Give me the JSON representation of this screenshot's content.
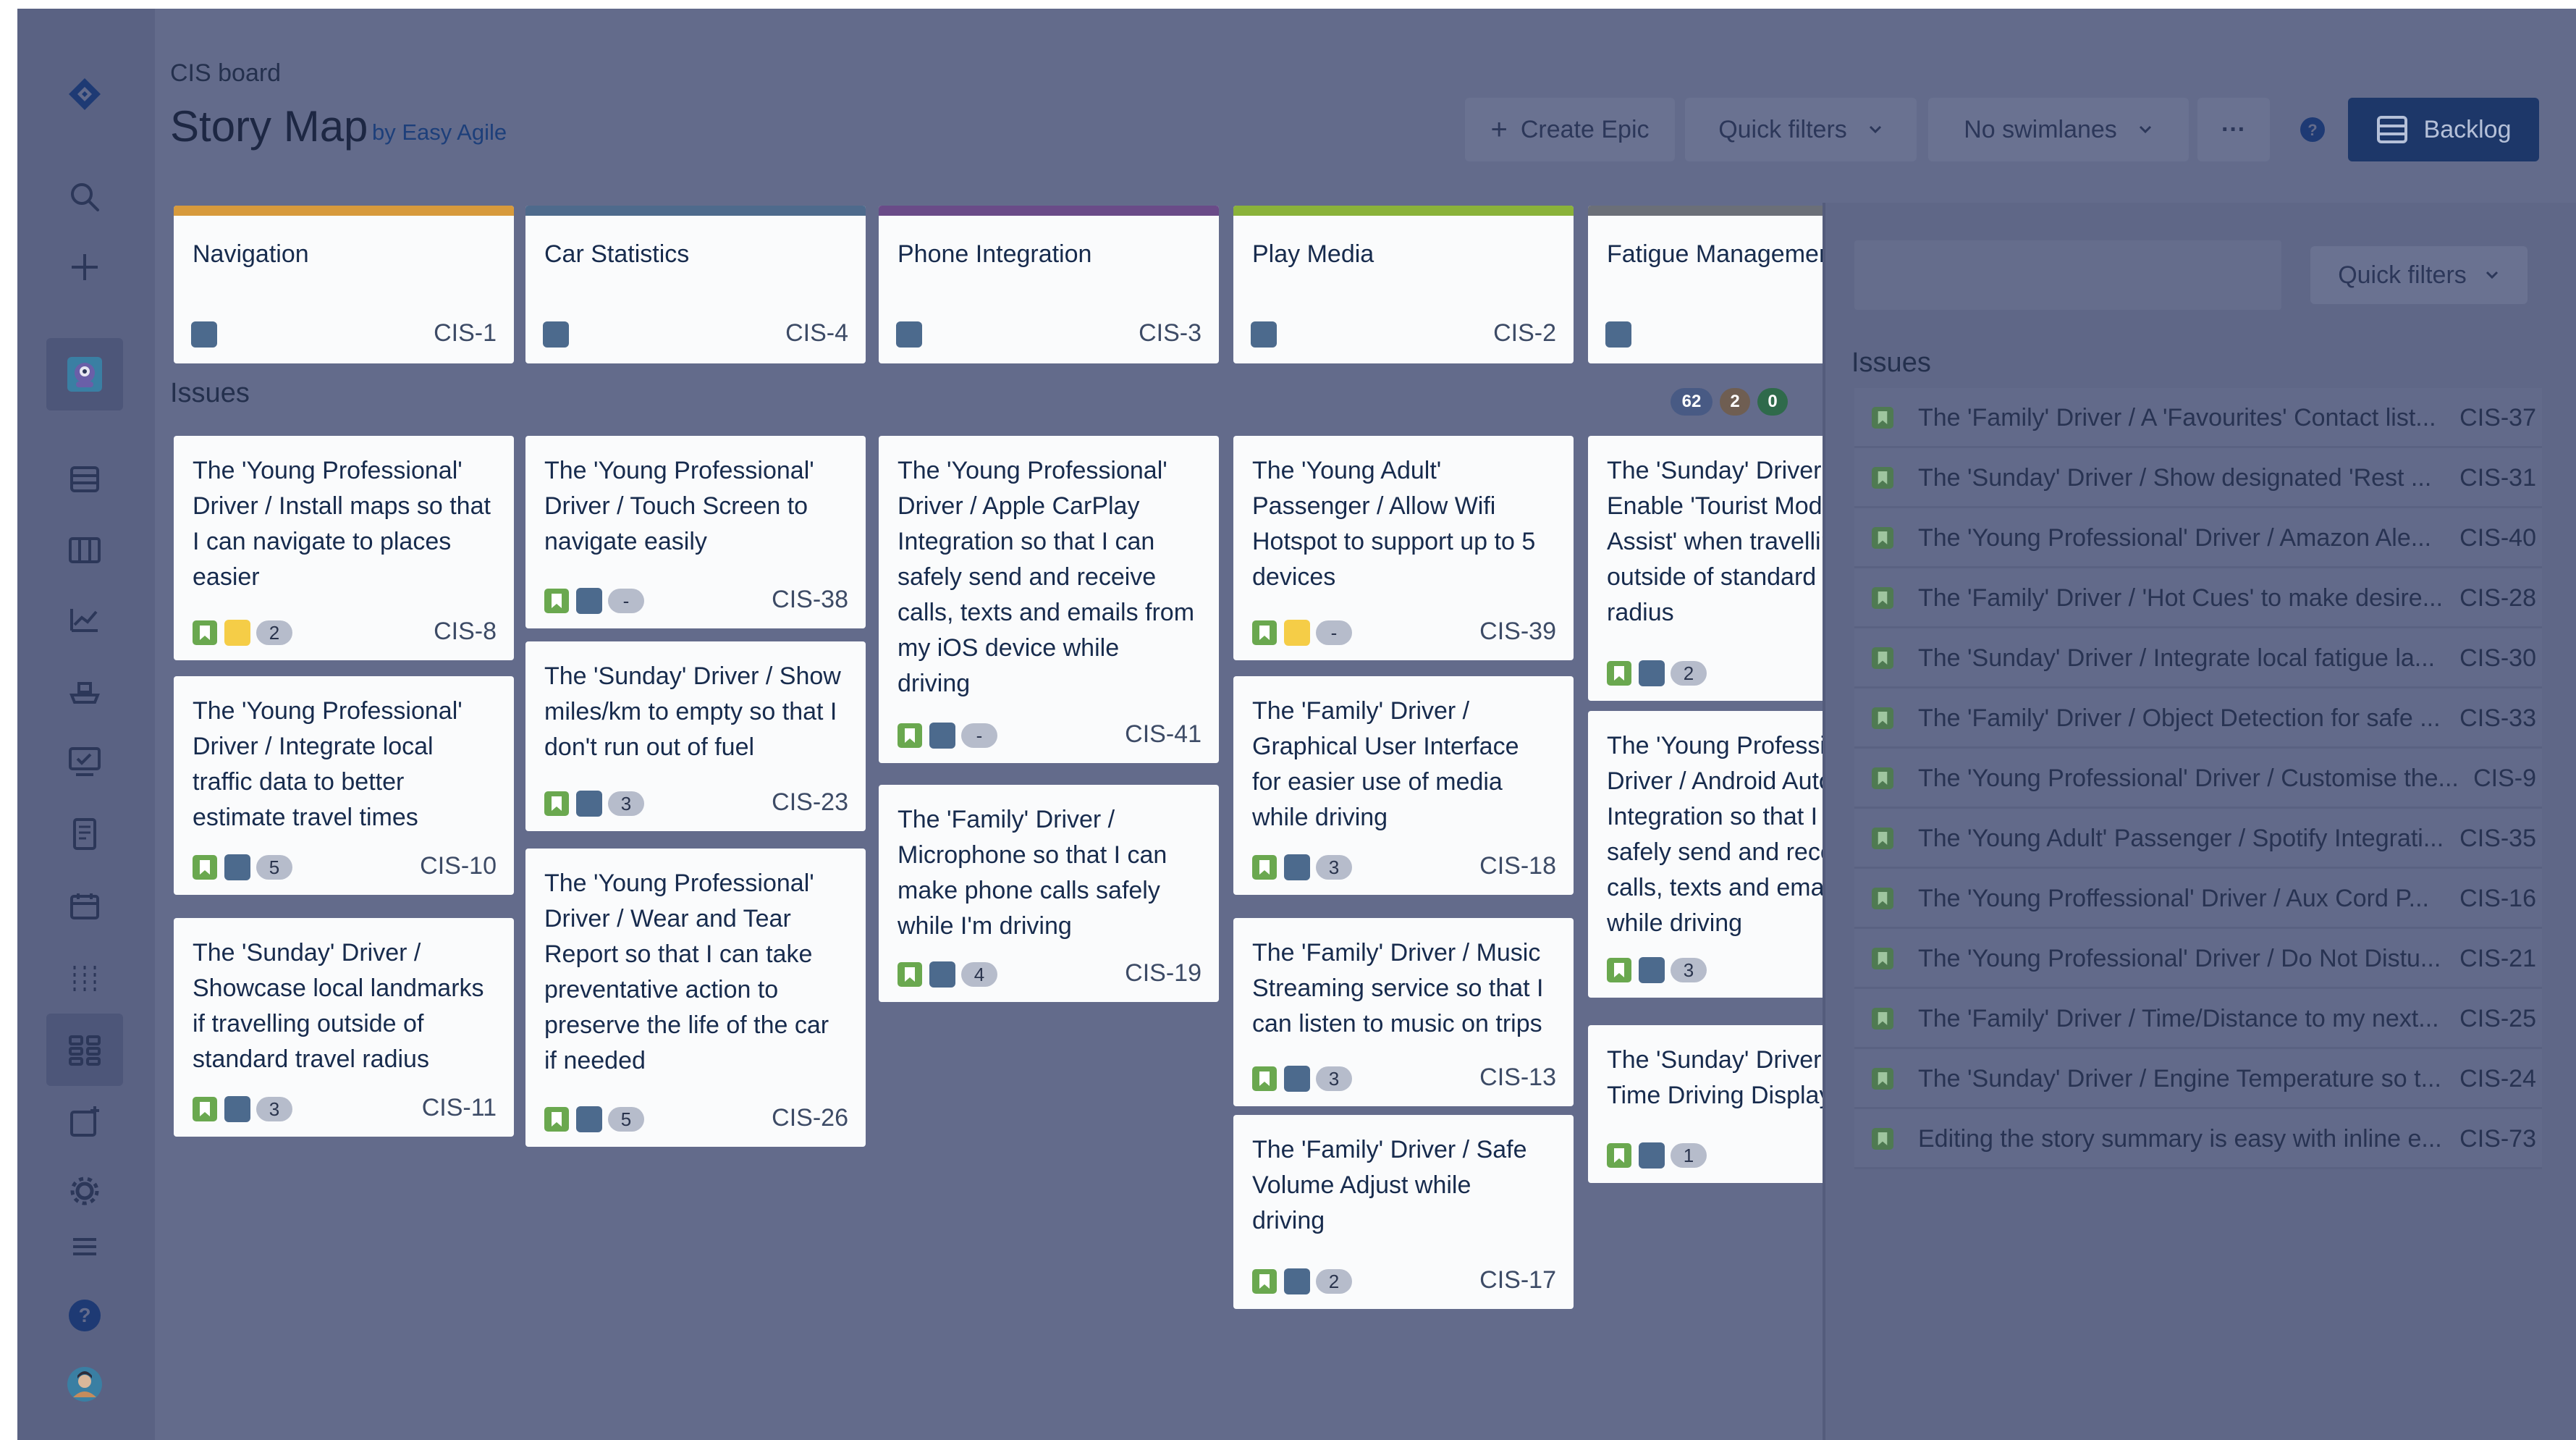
{
  "header": {
    "breadcrumb": "CIS board",
    "title": "Story Map",
    "title_sub": "by Easy Agile",
    "create_epic_label": "Create Epic",
    "quick_filters_label": "Quick filters",
    "swimlanes_label": "No swimlanes",
    "more_label": "···",
    "backlog_label": "Backlog"
  },
  "nav_icons": [
    "jira-logo-icon",
    "search-icon",
    "create-plus-icon",
    "project-avatar-icon",
    "backlog-icon",
    "board-columns-icon",
    "reports-icon",
    "releases-icon",
    "issues-icon",
    "pages-icon",
    "calendar-icon",
    "components-icon",
    "story-map-icon",
    "add-item-icon",
    "settings-icon",
    "menu-icon",
    "help-icon",
    "user-avatar-icon"
  ],
  "colors": {
    "story": "#6aa84f",
    "swatch_blue": "#4c6a8d",
    "swatch_yellow": "#f5cd47",
    "epic_navigation": "#d79a3c",
    "epic_car_statistics": "#4e6a8c",
    "epic_phone_integration": "#6a4b88",
    "epic_play_media": "#8ab23a",
    "epic_fatigue_management": "#6b6f78",
    "badge_blue": "#485a84",
    "badge_orange": "#6f5e52",
    "badge_green": "#2f6a4b"
  },
  "epics": [
    {
      "name": "Navigation",
      "key": "CIS-1"
    },
    {
      "name": "Car Statistics",
      "key": "CIS-4"
    },
    {
      "name": "Phone Integration",
      "key": "CIS-3"
    },
    {
      "name": "Play Media",
      "key": "CIS-2"
    },
    {
      "name": "Fatigue Management",
      "key": ""
    }
  ],
  "issues_label": "Issues",
  "issue_counts": {
    "todo": "62",
    "in_progress": "2",
    "done": "0"
  },
  "columns": [
    {
      "cards": [
        {
          "summary": "The 'Young Professional'\nDriver / Install maps so that\nI can navigate to places\neasier",
          "key": "CIS-8",
          "swatch": "yellow",
          "count": "2"
        },
        {
          "summary": "The 'Young Professional'\nDriver / Integrate local\ntraffic data to better\nestimate travel times",
          "key": "CIS-10",
          "swatch": "blue",
          "count": "5"
        },
        {
          "summary": "The 'Sunday' Driver /\nShowcase local landmarks\nif travelling outside of\nstandard travel radius",
          "key": "CIS-11",
          "swatch": "blue",
          "count": "3"
        }
      ]
    },
    {
      "cards": [
        {
          "summary": "The 'Young Professional'\nDriver / Touch Screen to\nnavigate easily",
          "key": "CIS-38",
          "swatch": "blue",
          "count": "-"
        },
        {
          "summary": "The 'Sunday' Driver / Show\nmiles/km to empty so that I\ndon't run out of fuel",
          "key": "CIS-23",
          "swatch": "blue",
          "count": "3"
        },
        {
          "summary": "The 'Young Professional'\nDriver / Wear and Tear\nReport so that I can take\npreventative action to\npreserve the life of the car\nif needed",
          "key": "CIS-26",
          "swatch": "blue",
          "count": "5"
        }
      ]
    },
    {
      "cards": [
        {
          "summary": "The 'Young Professional'\nDriver / Apple CarPlay\nIntegration so that I can\nsafely send and receive\ncalls, texts and emails from\nmy iOS device while\ndriving",
          "key": "CIS-41",
          "swatch": "blue",
          "count": "-"
        },
        {
          "summary": "The 'Family' Driver /\nMicrophone so that I can\nmake phone calls safely\nwhile I'm driving",
          "key": "CIS-19",
          "swatch": "blue",
          "count": "4"
        }
      ]
    },
    {
      "cards": [
        {
          "summary": "The 'Young Adult'\nPassenger / Allow Wifi\nHotspot to support up to 5\ndevices",
          "key": "CIS-39",
          "swatch": "yellow",
          "count": "-"
        },
        {
          "summary": "The 'Family' Driver /\nGraphical User Interface\nfor easier use of media\nwhile driving",
          "key": "CIS-18",
          "swatch": "blue",
          "count": "3"
        },
        {
          "summary": "The 'Family' Driver / Music\nStreaming service so that I\ncan listen to music on trips",
          "key": "CIS-13",
          "swatch": "blue",
          "count": "3"
        },
        {
          "summary": "The 'Family' Driver / Safe\nVolume Adjust while\ndriving",
          "key": "CIS-17",
          "swatch": "blue",
          "count": "2"
        }
      ]
    },
    {
      "cards": [
        {
          "summary": "The 'Sunday' Driver /\nEnable 'Tourist Mode\nAssist' when travelling\noutside of standard t\nradius",
          "key": "",
          "swatch": "blue",
          "count": "2"
        },
        {
          "summary": "The 'Young Professio\nDriver / Android Auto\nIntegration so that I c\nsafely send and rece\ncalls, texts and emai\nwhile driving",
          "key": "",
          "swatch": "blue",
          "count": "3"
        },
        {
          "summary": "The 'Sunday' Driver /\nTime Driving Display",
          "key": "",
          "swatch": "blue",
          "count": "1"
        }
      ]
    }
  ],
  "panel": {
    "quick_filters_label": "Quick filters",
    "title": "Issues",
    "items": [
      {
        "text": "The 'Family' Driver / A 'Favourites' Contact list...",
        "key": "CIS-37"
      },
      {
        "text": "The 'Sunday' Driver / Show designated 'Rest ...",
        "key": "CIS-31"
      },
      {
        "text": "The 'Young Professional' Driver / Amazon Ale...",
        "key": "CIS-40"
      },
      {
        "text": "The 'Family' Driver / 'Hot Cues' to make desire...",
        "key": "CIS-28"
      },
      {
        "text": "The 'Sunday' Driver / Integrate local fatigue la...",
        "key": "CIS-30"
      },
      {
        "text": "The 'Family' Driver / Object Detection for safe ...",
        "key": "CIS-33"
      },
      {
        "text": "The 'Young Professional' Driver / Customise the...",
        "key": "CIS-9"
      },
      {
        "text": "The 'Young Adult' Passenger / Spotify Integrati...",
        "key": "CIS-35"
      },
      {
        "text": "The 'Young Proffessional' Driver / Aux Cord P...",
        "key": "CIS-16"
      },
      {
        "text": "The 'Young Professional' Driver / Do Not Distu...",
        "key": "CIS-21"
      },
      {
        "text": "The 'Family' Driver / Time/Distance to my next...",
        "key": "CIS-25"
      },
      {
        "text": "The 'Sunday' Driver / Engine Temperature so t...",
        "key": "CIS-24"
      },
      {
        "text": "Editing the story summary is easy with inline e...",
        "key": "CIS-73"
      }
    ]
  }
}
